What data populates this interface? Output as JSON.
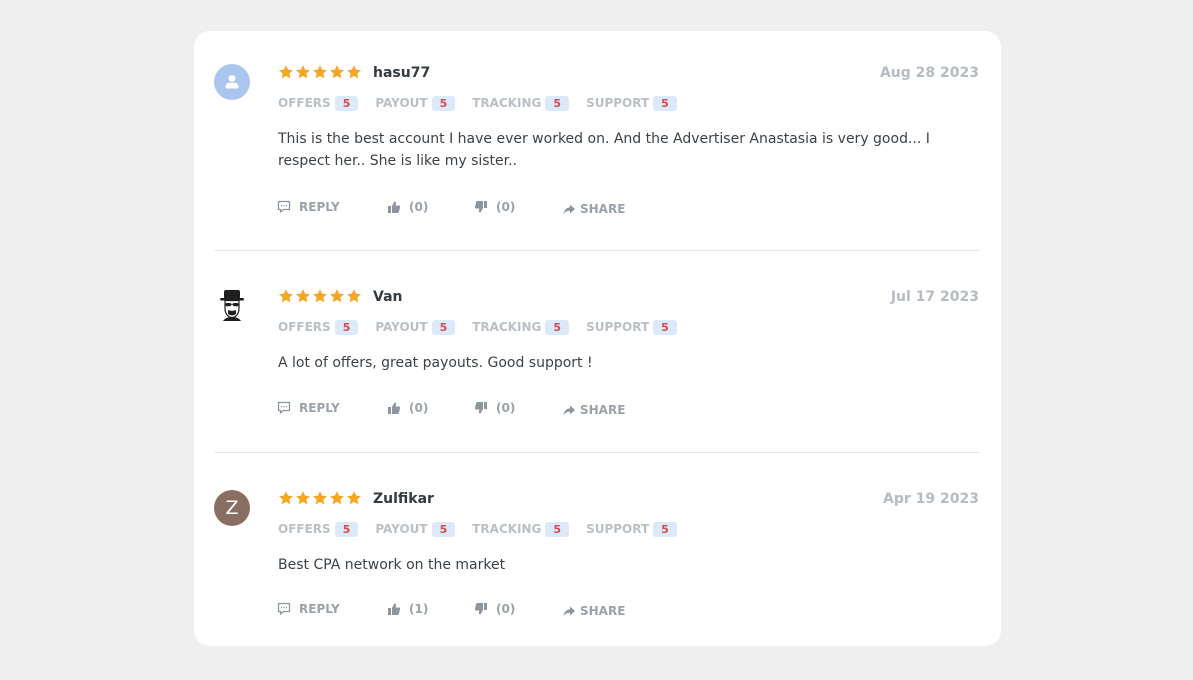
{
  "reviews": [
    {
      "author": "hasu77",
      "date": "Aug 28 2023",
      "avatar": "user-icon",
      "rating": 5,
      "metrics": [
        {
          "label": "OFFERS",
          "value": "5"
        },
        {
          "label": "PAYOUT",
          "value": "5"
        },
        {
          "label": "TRACKING",
          "value": "5"
        },
        {
          "label": "SUPPORT",
          "value": "5"
        }
      ],
      "text": "This is the best account I have ever worked on. And the Advertiser Anastasia is very good... I respect her.. She is like my sister..",
      "reply_label": "REPLY",
      "likes": "(0)",
      "dislikes": "(0)",
      "share_label": "SHARE"
    },
    {
      "author": "Van",
      "date": "Jul 17 2023",
      "avatar": "heisenberg-icon",
      "rating": 5,
      "metrics": [
        {
          "label": "OFFERS",
          "value": "5"
        },
        {
          "label": "PAYOUT",
          "value": "5"
        },
        {
          "label": "TRACKING",
          "value": "5"
        },
        {
          "label": "SUPPORT",
          "value": "5"
        }
      ],
      "text": "A lot of offers, great payouts. Good support !",
      "reply_label": "REPLY",
      "likes": "(0)",
      "dislikes": "(0)",
      "share_label": "SHARE"
    },
    {
      "author": "Zulfikar",
      "date": "Apr 19 2023",
      "avatar_letter": "Z",
      "rating": 5,
      "metrics": [
        {
          "label": "OFFERS",
          "value": "5"
        },
        {
          "label": "PAYOUT",
          "value": "5"
        },
        {
          "label": "TRACKING",
          "value": "5"
        },
        {
          "label": "SUPPORT",
          "value": "5"
        }
      ],
      "text": "Best CPA network on the market",
      "reply_label": "REPLY",
      "likes": "(1)",
      "dislikes": "(0)",
      "share_label": "SHARE"
    }
  ],
  "colors": {
    "star": "#f5a623",
    "badge_bg": "#dbe9fb",
    "badge_text": "#d94a4a",
    "muted": "#9aa2ab"
  }
}
